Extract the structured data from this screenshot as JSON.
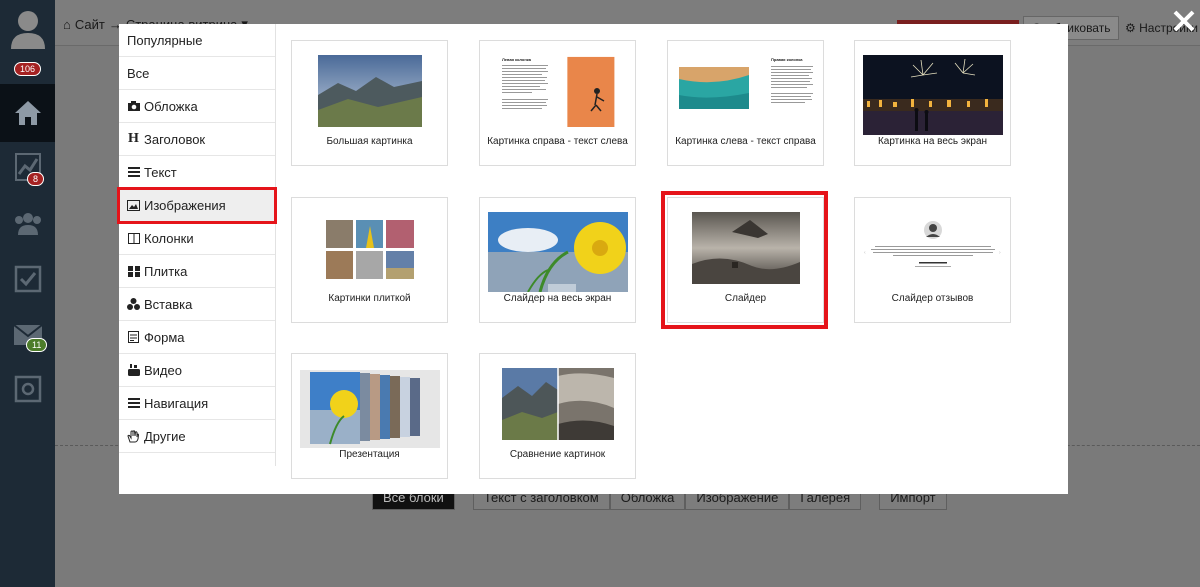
{
  "app": {
    "breadcrumb": {
      "site": "Сайт",
      "arrow": "→",
      "page": "Страница витрина"
    },
    "badges": {
      "avatar": "106",
      "stats": "8",
      "mail": "11"
    },
    "topbar": {
      "publish_label": "Опубликовать",
      "settings_label": "Настройки"
    },
    "bottom_tabs": [
      "Все блоки",
      "Текст с заголовком",
      "Обложка",
      "Изображение",
      "Галерея"
    ],
    "import_label": "Импорт"
  },
  "modal": {
    "categories": [
      {
        "label": "Популярные",
        "icon": ""
      },
      {
        "label": "Все",
        "icon": ""
      },
      {
        "label": "Обложка",
        "icon": "camera-icon"
      },
      {
        "label": "Заголовок",
        "icon": "heading-icon"
      },
      {
        "label": "Текст",
        "icon": "text-lines-icon"
      },
      {
        "label": "Изображения",
        "icon": "image-icon"
      },
      {
        "label": "Колонки",
        "icon": "columns-icon"
      },
      {
        "label": "Плитка",
        "icon": "tiles-icon"
      },
      {
        "label": "Вставка",
        "icon": "embed-icon"
      },
      {
        "label": "Форма",
        "icon": "form-icon"
      },
      {
        "label": "Видео",
        "icon": "youtube-icon"
      },
      {
        "label": "Навигация",
        "icon": "menu-icon"
      },
      {
        "label": "Другие",
        "icon": "hand-icon"
      }
    ],
    "active_category": "Изображения",
    "blocks": [
      {
        "label": "Большая картинка"
      },
      {
        "label": "Картинка справа - текст слева",
        "heading": "Левая колонка"
      },
      {
        "label": "Картинка слева - текст справа",
        "heading": "Правая колонка"
      },
      {
        "label": "Картинка на весь экран"
      },
      {
        "label": "Картинки плиткой"
      },
      {
        "label": "Слайдер на весь экран"
      },
      {
        "label": "Слайдер"
      },
      {
        "label": "Слайдер отзывов"
      },
      {
        "label": "Презентация"
      },
      {
        "label": "Сравнение картинок"
      }
    ],
    "selected_block": "Слайдер"
  },
  "colors": {
    "highlight": "#e5141a",
    "sidebar": "#1d2a36"
  }
}
